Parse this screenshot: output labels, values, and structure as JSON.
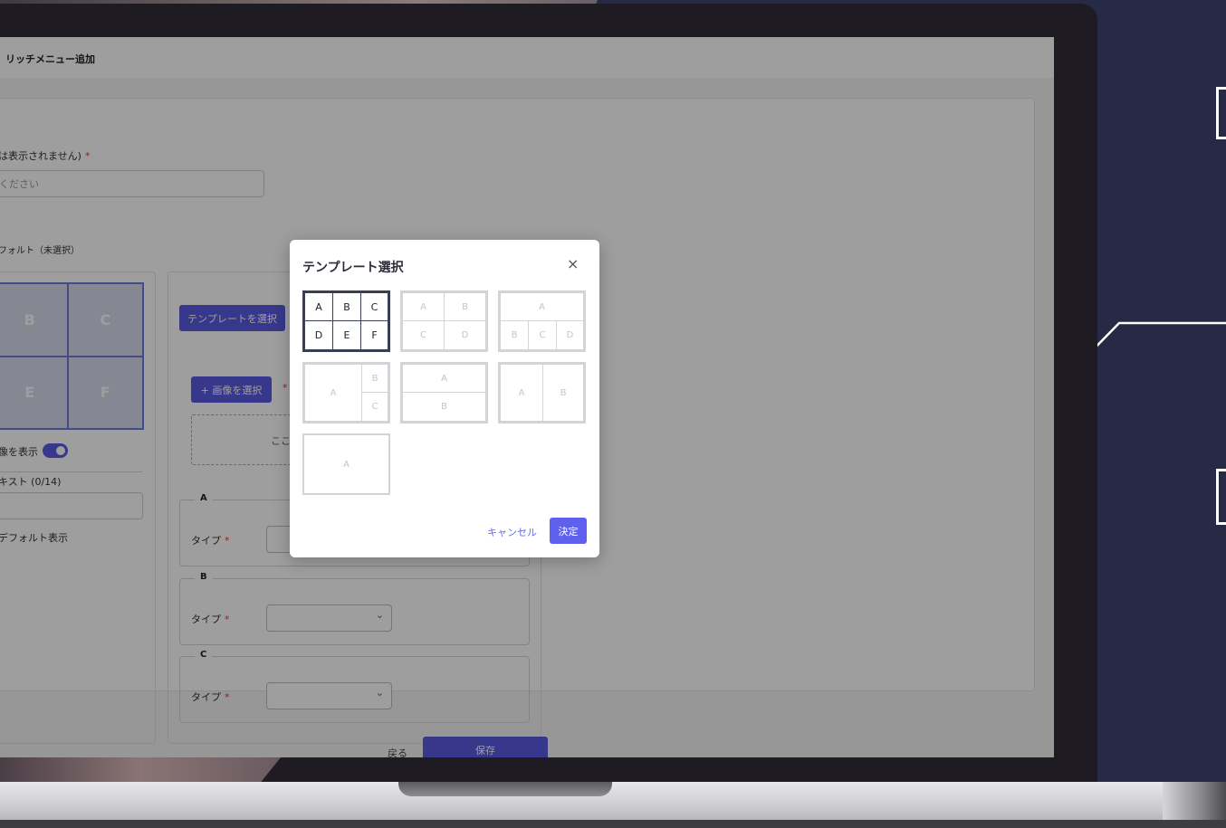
{
  "header": {
    "title": "リッチメニュー追加"
  },
  "form": {
    "name_label": "は表示されません)",
    "name_placeholder": "ください",
    "default_label": "フォルト（未選択）",
    "show_image_label": "像を表示",
    "text_label": "キスト (0/14)",
    "default_display_label": "デフォルト表示",
    "template_button": "テンプレートを選択",
    "image_button": "+ 画像を選択",
    "dropzone_text": "ここ",
    "grid_cells": [
      "B",
      "C",
      "E",
      "F"
    ],
    "sections": [
      {
        "legend": "A",
        "type_label": "タイプ"
      },
      {
        "legend": "B",
        "type_label": "タイプ"
      },
      {
        "legend": "C",
        "type_label": "タイプ"
      }
    ],
    "required_mark": "*"
  },
  "footer": {
    "back": "戻る",
    "save": "保存"
  },
  "modal": {
    "title": "テンプレート選択",
    "close": "×",
    "cancel": "キャンセル",
    "ok": "決定",
    "templates": [
      {
        "cells": [
          "A",
          "B",
          "C",
          "D",
          "E",
          "F"
        ],
        "selected": true
      },
      {
        "cells": [
          "A",
          "B",
          "C",
          "D"
        ],
        "selected": false
      },
      {
        "cells": [
          "A",
          "B",
          "C",
          "D"
        ],
        "selected": false
      },
      {
        "cells": [
          "A",
          "B",
          "C"
        ],
        "selected": false
      },
      {
        "cells": [
          "A",
          "B"
        ],
        "selected": false
      },
      {
        "cells": [
          "A",
          "B"
        ],
        "selected": false
      },
      {
        "cells": [
          "A"
        ],
        "selected": false
      }
    ]
  },
  "colors": {
    "primary": "#5a5be0",
    "background": "#262a45",
    "required": "#e53935"
  }
}
